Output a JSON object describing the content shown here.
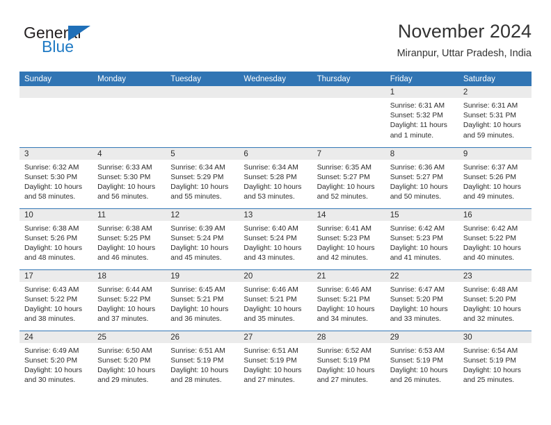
{
  "logo": {
    "word_top": "General",
    "word_bottom": "Blue",
    "triangle_icon": "triangle-icon",
    "color_dark": "#231f20",
    "color_blue": "#1f7ac4"
  },
  "header": {
    "title": "November 2024",
    "subtitle": "Miranpur, Uttar Pradesh, India"
  },
  "theme": {
    "header_blue": "#3175b4",
    "date_band_gray": "#ebebeb",
    "text": "#2b2b2b"
  },
  "weekday_headers": [
    "Sunday",
    "Monday",
    "Tuesday",
    "Wednesday",
    "Thursday",
    "Friday",
    "Saturday"
  ],
  "weeks": [
    [
      {
        "date": "",
        "sunrise": "",
        "sunset": "",
        "daylight": "",
        "empty": true
      },
      {
        "date": "",
        "sunrise": "",
        "sunset": "",
        "daylight": "",
        "empty": true
      },
      {
        "date": "",
        "sunrise": "",
        "sunset": "",
        "daylight": "",
        "empty": true
      },
      {
        "date": "",
        "sunrise": "",
        "sunset": "",
        "daylight": "",
        "empty": true
      },
      {
        "date": "",
        "sunrise": "",
        "sunset": "",
        "daylight": "",
        "empty": true
      },
      {
        "date": "1",
        "sunrise": "Sunrise: 6:31 AM",
        "sunset": "Sunset: 5:32 PM",
        "daylight": "Daylight: 11 hours and 1 minute.",
        "empty": false
      },
      {
        "date": "2",
        "sunrise": "Sunrise: 6:31 AM",
        "sunset": "Sunset: 5:31 PM",
        "daylight": "Daylight: 10 hours and 59 minutes.",
        "empty": false
      }
    ],
    [
      {
        "date": "3",
        "sunrise": "Sunrise: 6:32 AM",
        "sunset": "Sunset: 5:30 PM",
        "daylight": "Daylight: 10 hours and 58 minutes.",
        "empty": false
      },
      {
        "date": "4",
        "sunrise": "Sunrise: 6:33 AM",
        "sunset": "Sunset: 5:30 PM",
        "daylight": "Daylight: 10 hours and 56 minutes.",
        "empty": false
      },
      {
        "date": "5",
        "sunrise": "Sunrise: 6:34 AM",
        "sunset": "Sunset: 5:29 PM",
        "daylight": "Daylight: 10 hours and 55 minutes.",
        "empty": false
      },
      {
        "date": "6",
        "sunrise": "Sunrise: 6:34 AM",
        "sunset": "Sunset: 5:28 PM",
        "daylight": "Daylight: 10 hours and 53 minutes.",
        "empty": false
      },
      {
        "date": "7",
        "sunrise": "Sunrise: 6:35 AM",
        "sunset": "Sunset: 5:27 PM",
        "daylight": "Daylight: 10 hours and 52 minutes.",
        "empty": false
      },
      {
        "date": "8",
        "sunrise": "Sunrise: 6:36 AM",
        "sunset": "Sunset: 5:27 PM",
        "daylight": "Daylight: 10 hours and 50 minutes.",
        "empty": false
      },
      {
        "date": "9",
        "sunrise": "Sunrise: 6:37 AM",
        "sunset": "Sunset: 5:26 PM",
        "daylight": "Daylight: 10 hours and 49 minutes.",
        "empty": false
      }
    ],
    [
      {
        "date": "10",
        "sunrise": "Sunrise: 6:38 AM",
        "sunset": "Sunset: 5:26 PM",
        "daylight": "Daylight: 10 hours and 48 minutes.",
        "empty": false
      },
      {
        "date": "11",
        "sunrise": "Sunrise: 6:38 AM",
        "sunset": "Sunset: 5:25 PM",
        "daylight": "Daylight: 10 hours and 46 minutes.",
        "empty": false
      },
      {
        "date": "12",
        "sunrise": "Sunrise: 6:39 AM",
        "sunset": "Sunset: 5:24 PM",
        "daylight": "Daylight: 10 hours and 45 minutes.",
        "empty": false
      },
      {
        "date": "13",
        "sunrise": "Sunrise: 6:40 AM",
        "sunset": "Sunset: 5:24 PM",
        "daylight": "Daylight: 10 hours and 43 minutes.",
        "empty": false
      },
      {
        "date": "14",
        "sunrise": "Sunrise: 6:41 AM",
        "sunset": "Sunset: 5:23 PM",
        "daylight": "Daylight: 10 hours and 42 minutes.",
        "empty": false
      },
      {
        "date": "15",
        "sunrise": "Sunrise: 6:42 AM",
        "sunset": "Sunset: 5:23 PM",
        "daylight": "Daylight: 10 hours and 41 minutes.",
        "empty": false
      },
      {
        "date": "16",
        "sunrise": "Sunrise: 6:42 AM",
        "sunset": "Sunset: 5:22 PM",
        "daylight": "Daylight: 10 hours and 40 minutes.",
        "empty": false
      }
    ],
    [
      {
        "date": "17",
        "sunrise": "Sunrise: 6:43 AM",
        "sunset": "Sunset: 5:22 PM",
        "daylight": "Daylight: 10 hours and 38 minutes.",
        "empty": false
      },
      {
        "date": "18",
        "sunrise": "Sunrise: 6:44 AM",
        "sunset": "Sunset: 5:22 PM",
        "daylight": "Daylight: 10 hours and 37 minutes.",
        "empty": false
      },
      {
        "date": "19",
        "sunrise": "Sunrise: 6:45 AM",
        "sunset": "Sunset: 5:21 PM",
        "daylight": "Daylight: 10 hours and 36 minutes.",
        "empty": false
      },
      {
        "date": "20",
        "sunrise": "Sunrise: 6:46 AM",
        "sunset": "Sunset: 5:21 PM",
        "daylight": "Daylight: 10 hours and 35 minutes.",
        "empty": false
      },
      {
        "date": "21",
        "sunrise": "Sunrise: 6:46 AM",
        "sunset": "Sunset: 5:21 PM",
        "daylight": "Daylight: 10 hours and 34 minutes.",
        "empty": false
      },
      {
        "date": "22",
        "sunrise": "Sunrise: 6:47 AM",
        "sunset": "Sunset: 5:20 PM",
        "daylight": "Daylight: 10 hours and 33 minutes.",
        "empty": false
      },
      {
        "date": "23",
        "sunrise": "Sunrise: 6:48 AM",
        "sunset": "Sunset: 5:20 PM",
        "daylight": "Daylight: 10 hours and 32 minutes.",
        "empty": false
      }
    ],
    [
      {
        "date": "24",
        "sunrise": "Sunrise: 6:49 AM",
        "sunset": "Sunset: 5:20 PM",
        "daylight": "Daylight: 10 hours and 30 minutes.",
        "empty": false
      },
      {
        "date": "25",
        "sunrise": "Sunrise: 6:50 AM",
        "sunset": "Sunset: 5:20 PM",
        "daylight": "Daylight: 10 hours and 29 minutes.",
        "empty": false
      },
      {
        "date": "26",
        "sunrise": "Sunrise: 6:51 AM",
        "sunset": "Sunset: 5:19 PM",
        "daylight": "Daylight: 10 hours and 28 minutes.",
        "empty": false
      },
      {
        "date": "27",
        "sunrise": "Sunrise: 6:51 AM",
        "sunset": "Sunset: 5:19 PM",
        "daylight": "Daylight: 10 hours and 27 minutes.",
        "empty": false
      },
      {
        "date": "28",
        "sunrise": "Sunrise: 6:52 AM",
        "sunset": "Sunset: 5:19 PM",
        "daylight": "Daylight: 10 hours and 27 minutes.",
        "empty": false
      },
      {
        "date": "29",
        "sunrise": "Sunrise: 6:53 AM",
        "sunset": "Sunset: 5:19 PM",
        "daylight": "Daylight: 10 hours and 26 minutes.",
        "empty": false
      },
      {
        "date": "30",
        "sunrise": "Sunrise: 6:54 AM",
        "sunset": "Sunset: 5:19 PM",
        "daylight": "Daylight: 10 hours and 25 minutes.",
        "empty": false
      }
    ]
  ]
}
